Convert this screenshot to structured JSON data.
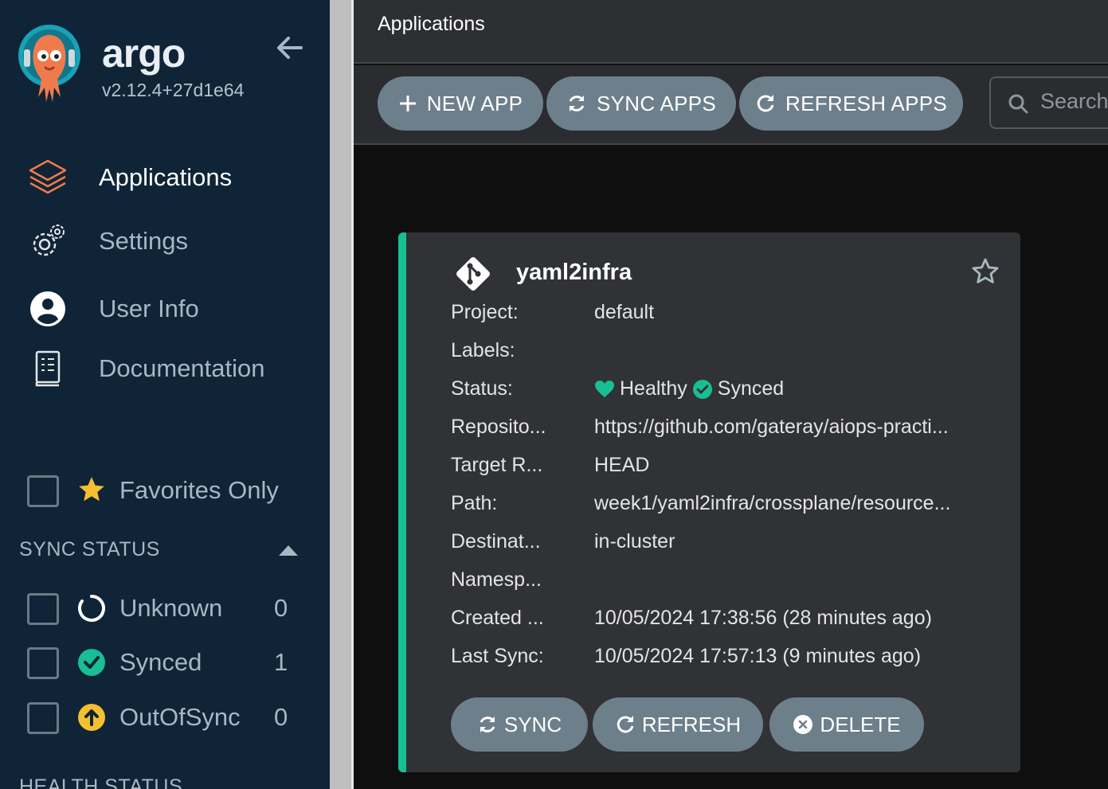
{
  "brand": {
    "name": "argo",
    "version": "v2.12.4+27d1e64"
  },
  "nav": [
    {
      "label": "Applications",
      "icon": "layers-icon",
      "active": true
    },
    {
      "label": "Settings",
      "icon": "gears-icon",
      "active": false
    },
    {
      "label": "User Info",
      "icon": "user-circle-icon",
      "active": false
    },
    {
      "label": "Documentation",
      "icon": "book-icon",
      "active": false
    }
  ],
  "filters": {
    "favorites_label": "Favorites Only",
    "sync_status_title": "SYNC STATUS",
    "sync_status": [
      {
        "label": "Unknown",
        "count": "0",
        "icon": "circle-notch-icon"
      },
      {
        "label": "Synced",
        "count": "1",
        "icon": "check-circle-icon"
      },
      {
        "label": "OutOfSync",
        "count": "0",
        "icon": "arrow-up-circle-icon"
      }
    ],
    "health_status_title": "HEALTH STATUS"
  },
  "header": {
    "title": "Applications"
  },
  "toolbar": {
    "new_app": "NEW APP",
    "sync_apps": "SYNC APPS",
    "refresh_apps": "REFRESH APPS",
    "search_placeholder": "Search"
  },
  "app_card": {
    "name": "yaml2infra",
    "fields": {
      "project": {
        "key": "Project:",
        "value": "default"
      },
      "labels": {
        "key": "Labels:",
        "value": ""
      },
      "status": {
        "key": "Status:",
        "health": "Healthy",
        "sync": "Synced"
      },
      "repository": {
        "key": "Reposito...",
        "value": "https://github.com/gateray/aiops-practi..."
      },
      "target_revision": {
        "key": "Target R...",
        "value": "HEAD"
      },
      "path": {
        "key": "Path:",
        "value": "week1/yaml2infra/crossplane/resource..."
      },
      "destination": {
        "key": "Destinat...",
        "value": "in-cluster"
      },
      "namespace": {
        "key": "Namesp...",
        "value": ""
      },
      "created": {
        "key": "Created ...",
        "value": "10/05/2024 17:38:56  (28 minutes ago)"
      },
      "last_sync": {
        "key": "Last Sync:",
        "value": "10/05/2024 17:57:13  (9 minutes ago)"
      }
    },
    "buttons": {
      "sync": "SYNC",
      "refresh": "REFRESH",
      "delete": "DELETE"
    }
  },
  "colors": {
    "sidebar_bg": "#0f2437",
    "accent_green": "#18be94",
    "button_bg": "#6d7f8b",
    "out_of_sync": "#f4c030",
    "logo_orange": "#ef7b4d"
  }
}
